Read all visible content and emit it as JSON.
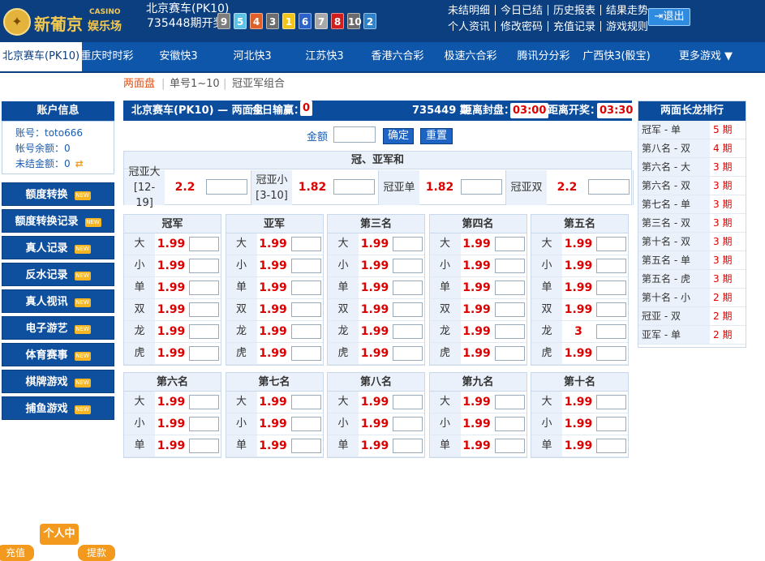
{
  "header": {
    "logo_text": "新葡京",
    "logo_casino": "CASINO",
    "logo_sub": "娱乐场",
    "game_name": "北京赛车(PK10)",
    "draw_label": "735448期开奖",
    "balls": [
      {
        "num": "9",
        "color": "#7d7d7d"
      },
      {
        "num": "5",
        "color": "#5ec1e6"
      },
      {
        "num": "4",
        "color": "#e0602a"
      },
      {
        "num": "3",
        "color": "#6e6e6e"
      },
      {
        "num": "1",
        "color": "#f2c31b"
      },
      {
        "num": "6",
        "color": "#2a62c9"
      },
      {
        "num": "7",
        "color": "#a9a9a9"
      },
      {
        "num": "8",
        "color": "#d31d1d"
      },
      {
        "num": "10",
        "color": "#6c6c6c"
      },
      {
        "num": "2",
        "color": "#2f82c8"
      }
    ],
    "links_row1": [
      "未结明细",
      "今日已结",
      "历史报表",
      "结果走势"
    ],
    "links_row2": [
      "个人资讯",
      "修改密码",
      "充值记录",
      "游戏规则"
    ],
    "logout": "退出"
  },
  "nav": [
    "北京赛车(PK10)",
    "重庆时时彩",
    "安徽快3",
    "河北快3",
    "江苏快3",
    "香港六合彩",
    "极速六合彩",
    "腾讯分分彩",
    "广西快3(骰宝)",
    "更多游戏 ▼"
  ],
  "subnav": [
    "两面盘",
    "单号1~10",
    "冠亚军组合"
  ],
  "account": {
    "title": "账户信息",
    "account_line": "账号：toto666",
    "balance_line": "帐号余额：0",
    "unsettled_line": "未结金额：0"
  },
  "sidebar_buttons": [
    "额度转换",
    "额度转换记录",
    "真人记录",
    "反水记录",
    "真人视讯",
    "电子游艺",
    "体育赛事",
    "棋牌游戏",
    "捕鱼游戏"
  ],
  "sidebar_tag": "NEW",
  "bottom": {
    "personal": "个人中",
    "deposit": "充值",
    "withdraw": "提款"
  },
  "main": {
    "title": "北京赛车(PK10) — 两面盘",
    "today_label": "今日输赢：",
    "today_value": "0",
    "period": "735449 期",
    "close_label": "距离封盘：",
    "close_time": "03:00",
    "draw_label": "距离开奖：",
    "draw_time": "03:30",
    "amount_label": "金额",
    "confirm": "确定",
    "reset": "重置"
  },
  "guanya": {
    "title": "冠、亚军和",
    "items": [
      {
        "name": "冠亚大[12-19]",
        "odds": "2.2"
      },
      {
        "name": "冠亚小[3-10]",
        "odds": "1.82"
      },
      {
        "name": "冠亚单",
        "odds": "1.82"
      },
      {
        "name": "冠亚双",
        "odds": "2.2"
      }
    ]
  },
  "rows_top": [
    "大",
    "小",
    "单",
    "双",
    "龙",
    "虎"
  ],
  "rows_bottom": [
    "大",
    "小",
    "单"
  ],
  "positions_top": [
    {
      "title": "冠军",
      "odds": [
        "1.99",
        "1.99",
        "1.99",
        "1.99",
        "1.99",
        "1.99"
      ]
    },
    {
      "title": "亚军",
      "odds": [
        "1.99",
        "1.99",
        "1.99",
        "1.99",
        "1.99",
        "1.99"
      ]
    },
    {
      "title": "第三名",
      "odds": [
        "1.99",
        "1.99",
        "1.99",
        "1.99",
        "1.99",
        "1.99"
      ]
    },
    {
      "title": "第四名",
      "odds": [
        "1.99",
        "1.99",
        "1.99",
        "1.99",
        "1.99",
        "1.99"
      ]
    },
    {
      "title": "第五名",
      "odds": [
        "1.99",
        "1.99",
        "1.99",
        "1.99",
        "3",
        "1.99"
      ]
    }
  ],
  "positions_bottom": [
    {
      "title": "第六名",
      "odds": [
        "1.99",
        "1.99",
        "1.99"
      ]
    },
    {
      "title": "第七名",
      "odds": [
        "1.99",
        "1.99",
        "1.99"
      ]
    },
    {
      "title": "第八名",
      "odds": [
        "1.99",
        "1.99",
        "1.99"
      ]
    },
    {
      "title": "第九名",
      "odds": [
        "1.99",
        "1.99",
        "1.99"
      ]
    },
    {
      "title": "第十名",
      "odds": [
        "1.99",
        "1.99",
        "1.99"
      ]
    }
  ],
  "ranking": {
    "title": "两面长龙排行",
    "items": [
      {
        "label": "冠军 - 单",
        "value": "5 期"
      },
      {
        "label": "第八名 - 双",
        "value": "4 期"
      },
      {
        "label": "第六名 - 大",
        "value": "3 期"
      },
      {
        "label": "第六名 - 双",
        "value": "3 期"
      },
      {
        "label": "第七名 - 单",
        "value": "3 期"
      },
      {
        "label": "第三名 - 双",
        "value": "3 期"
      },
      {
        "label": "第十名 - 双",
        "value": "3 期"
      },
      {
        "label": "第五名 - 单",
        "value": "3 期"
      },
      {
        "label": "第五名 - 虎",
        "value": "3 期"
      },
      {
        "label": "第十名 - 小",
        "value": "2 期"
      },
      {
        "label": "冠亚 - 双",
        "value": "2 期"
      },
      {
        "label": "亚军 - 单",
        "value": "2 期"
      }
    ]
  }
}
